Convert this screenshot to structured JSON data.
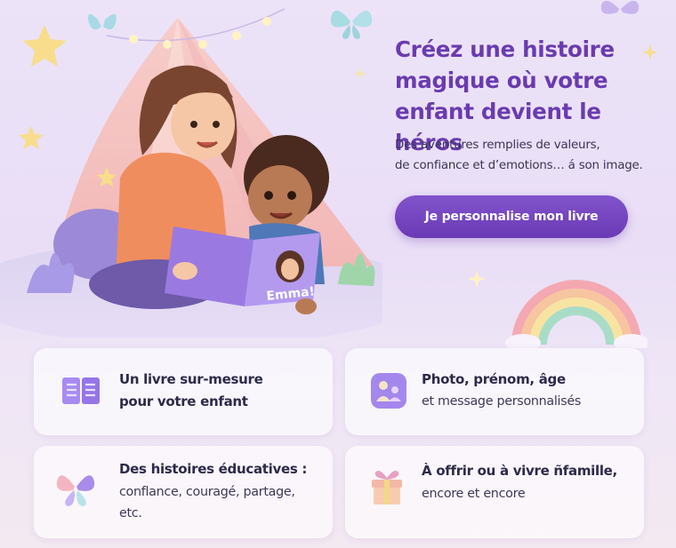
{
  "hero": {
    "title_lines": [
      "Créez une histoire",
      "magique où votre",
      "enfant devient le héros"
    ],
    "subtitle_lines": [
      "Des aventures remplies de valeurs,",
      "de confiance et d’emotions… á son image."
    ],
    "cta_label": "Je personnalise mon livre",
    "book_cover_text": "Emma!"
  },
  "features": [
    {
      "icon": "open-book-icon",
      "line1": "Un livre sur-mesure",
      "line2": "pour votre enfant"
    },
    {
      "icon": "photo-profile-icon",
      "line1": "Photo, prénom, âge",
      "line2": "et message personnalisés"
    },
    {
      "icon": "butterfly-icon",
      "line1": "Des histoires éducatives :",
      "line2": "conflance, couragé, partage,",
      "line3": "etc."
    },
    {
      "icon": "gift-box-icon",
      "line1": "À offrir ou à vivre ñfamille,",
      "line2": "encore et encore"
    }
  ],
  "colors": {
    "accent": "#6a3bb0",
    "cta_bg": "#7446bf",
    "text_dark": "#2d2a4a",
    "background": "#ece3f8"
  }
}
